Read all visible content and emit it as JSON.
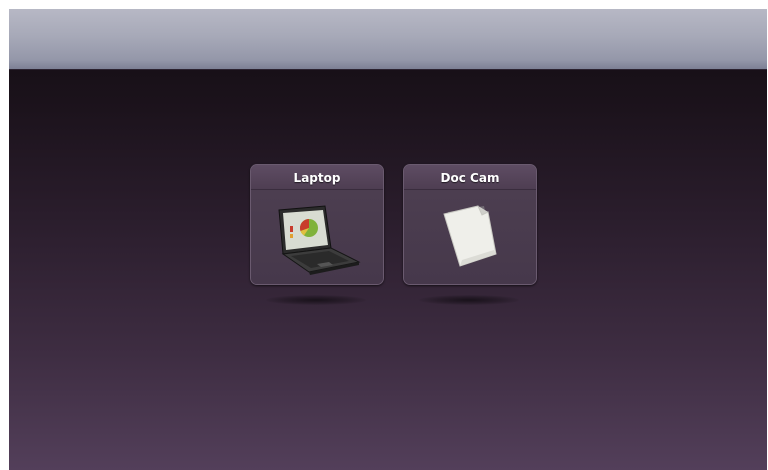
{
  "sources": [
    {
      "label": "Laptop",
      "icon": "laptop-icon"
    },
    {
      "label": "Doc Cam",
      "icon": "document-icon"
    }
  ],
  "colors": {
    "header": "#a0a3b3",
    "background_top": "#120d12",
    "background_bottom": "#533f5a",
    "tile": "#4a3b4e"
  }
}
